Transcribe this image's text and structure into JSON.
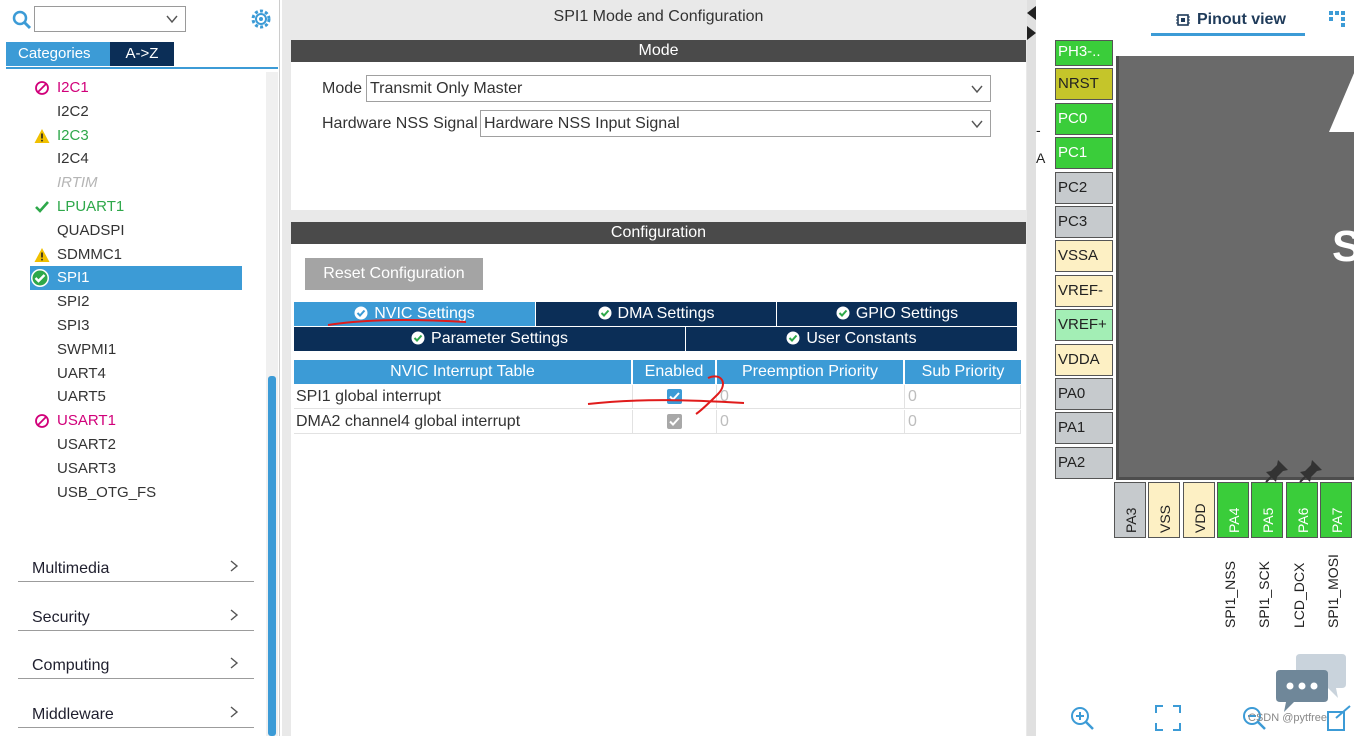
{
  "left": {
    "search": {
      "value": ""
    },
    "tabs": {
      "categories": "Categories",
      "az": "A->Z"
    },
    "items": [
      {
        "label": "I2C1",
        "state": "error"
      },
      {
        "label": "I2C2",
        "state": "none"
      },
      {
        "label": "I2C3",
        "state": "warn"
      },
      {
        "label": "I2C4",
        "state": "none"
      },
      {
        "label": "IRTIM",
        "state": "disabled"
      },
      {
        "label": "LPUART1",
        "state": "ok"
      },
      {
        "label": "QUADSPI",
        "state": "none"
      },
      {
        "label": "SDMMC1",
        "state": "warn2"
      },
      {
        "label": "SPI1",
        "state": "selected"
      },
      {
        "label": "SPI2",
        "state": "none"
      },
      {
        "label": "SPI3",
        "state": "none"
      },
      {
        "label": "SWPMI1",
        "state": "none"
      },
      {
        "label": "UART4",
        "state": "none"
      },
      {
        "label": "UART5",
        "state": "none"
      },
      {
        "label": "USART1",
        "state": "error"
      },
      {
        "label": "USART2",
        "state": "none"
      },
      {
        "label": "USART3",
        "state": "none"
      },
      {
        "label": "USB_OTG_FS",
        "state": "none"
      }
    ],
    "groups": [
      "Multimedia",
      "Security",
      "Computing",
      "Middleware"
    ]
  },
  "mid": {
    "title": "SPI1 Mode and Configuration",
    "mode_header": "Mode",
    "mode_label": "Mode",
    "mode_value": "Transmit Only Master",
    "nss_label": "Hardware NSS Signal",
    "nss_value": "Hardware NSS Input Signal",
    "config_header": "Configuration",
    "reset_label": "Reset Configuration",
    "subtabs": {
      "nvic": "NVIC Settings",
      "dma": "DMA Settings",
      "gpio": "GPIO Settings",
      "param": "Parameter Settings",
      "user": "User Constants"
    },
    "table": {
      "headers": [
        "NVIC Interrupt Table",
        "Enabled",
        "Preemption Priority",
        "Sub Priority"
      ],
      "rows": [
        {
          "name": "SPI1 global interrupt",
          "enabled": true,
          "preempt": "0",
          "sub": "0"
        },
        {
          "name": "DMA2 channel4 global interrupt",
          "enabled": true,
          "preempt": "0",
          "sub": "0"
        }
      ]
    }
  },
  "right": {
    "pinout_label": "Pinout view",
    "chip_text": "S",
    "left_pins": [
      {
        "label": "PH3-..",
        "color": "#3acd3a"
      },
      {
        "label": "NRST",
        "color": "#c5c52a"
      },
      {
        "label": "PC0",
        "color": "#3acd3a"
      },
      {
        "label": "PC1",
        "color": "#3acd3a"
      },
      {
        "label": "PC2",
        "color": "#c6cacd"
      },
      {
        "label": "PC3",
        "color": "#c6cacd"
      },
      {
        "label": "VSSA",
        "color": "#fdf0c4"
      },
      {
        "label": "VREF-",
        "color": "#fdf0c4"
      },
      {
        "label": "VREF+",
        "color": "#a3eeb5"
      },
      {
        "label": "VDDA",
        "color": "#fdf0c4"
      },
      {
        "label": "PA0",
        "color": "#c6cacd"
      },
      {
        "label": "PA1",
        "color": "#c6cacd"
      },
      {
        "label": "PA2",
        "color": "#c6cacd"
      }
    ],
    "bottom_pins": [
      {
        "label": "PA3",
        "color": "#c6cacd"
      },
      {
        "label": "VSS",
        "color": "#fdf0c4"
      },
      {
        "label": "VDD",
        "color": "#fdf0c4"
      },
      {
        "label": "PA4",
        "color": "#3acd3a"
      },
      {
        "label": "PA5",
        "color": "#3acd3a"
      },
      {
        "label": "PA6",
        "color": "#3acd3a"
      },
      {
        "label": "PA7",
        "color": "#3acd3a"
      }
    ],
    "signals": [
      "SPI1_NSS",
      "SPI1_SCK",
      "LCD_DCX",
      "SPI1_MOSI"
    ],
    "side_marks": [
      "-",
      "A"
    ],
    "watermark": "CSDN @pytfree"
  },
  "colors": {
    "accent": "#3c9bd6",
    "navy": "#0b2e57",
    "header_gray": "#4a4a4a",
    "error": "#d1007a",
    "ok": "#2ea84a",
    "warn": "#f0c000"
  }
}
